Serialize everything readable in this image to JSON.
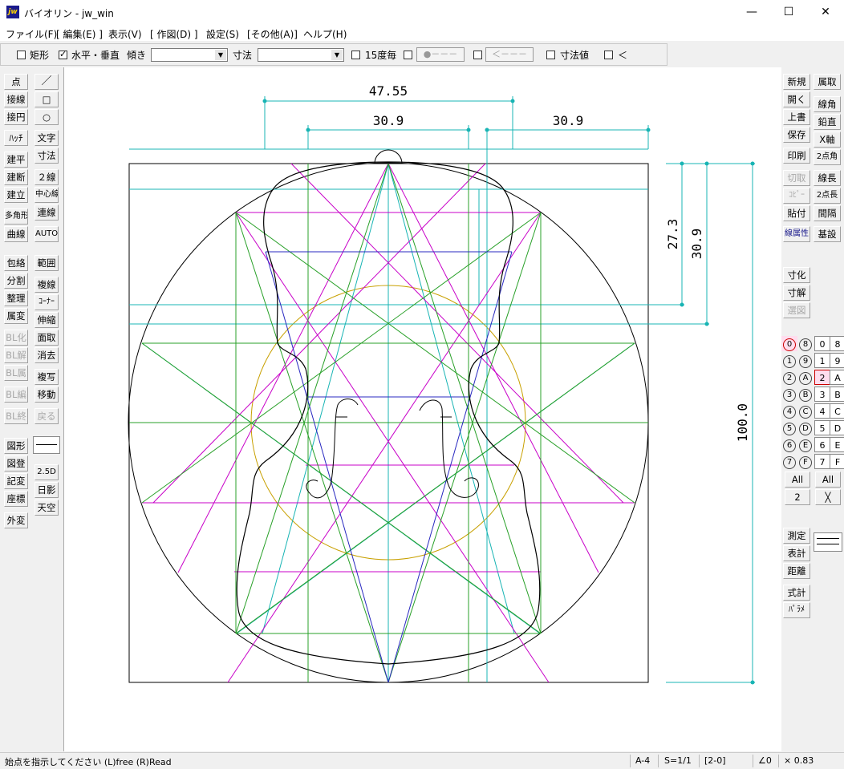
{
  "window": {
    "title": "バイオリン - jw_win",
    "app_icon": "jw",
    "minimize": "—",
    "maximize": "☐",
    "close": "✕"
  },
  "menu": [
    "ファイル(F)",
    "[ 編集(E) ]",
    "表示(V)",
    "[ 作図(D) ]",
    "設定(S)",
    "[その他(A)]",
    "ヘルプ(H)"
  ],
  "toolbar": {
    "rect_label": "矩形",
    "rect_checked": false,
    "hv_label": "水平・垂直",
    "hv_checked": true,
    "angle_label": "傾き",
    "angle_value": "",
    "dim_label": "寸法",
    "dim_value": "",
    "deg15_label": "15度毎",
    "deg15_checked": false,
    "pattern1": "●－－－",
    "pattern2": "＜－－－",
    "dimval_label": "寸法値",
    "dimval_checked": false,
    "lt_label": "＜"
  },
  "left_tools_a": [
    "点",
    "接線",
    "接円",
    "ﾊｯﾁ",
    "建平",
    "建断",
    "建立",
    "多角形",
    "曲線",
    "包絡",
    "分割",
    "整理",
    "属変",
    "BL化",
    "BL解",
    "BL属",
    "BL編",
    "BL終",
    "図形",
    "図登",
    "記変",
    "座標",
    "外変"
  ],
  "left_tools_b": [
    "／",
    "□",
    "○",
    "文字",
    "寸法",
    "２線",
    "中心線",
    "連線",
    "AUTO",
    "範囲",
    "複線",
    "ｺｰﾅｰ",
    "伸縮",
    "面取",
    "消去",
    "複写",
    "移動",
    "戻る",
    "2.5D",
    "日影",
    "天空"
  ],
  "right_tools_a": [
    "新規",
    "開く",
    "上書",
    "保存",
    "印刷",
    "切取",
    "ｺﾋﾟｰ",
    "貼付",
    "線属性",
    "寸化",
    "寸解",
    "選図",
    "測定",
    "表計",
    "距離",
    "式計",
    "ﾊﾟﾗﾒ"
  ],
  "right_tools_b": [
    "属取",
    "線角",
    "鉛直",
    "X軸",
    "2点角",
    "線長",
    "2点長",
    "間隔",
    "基設"
  ],
  "layers": {
    "group_col": [
      "0",
      "1",
      "2",
      "3",
      "4",
      "5",
      "6",
      "7"
    ],
    "group_col2": [
      "8",
      "9",
      "A",
      "B",
      "C",
      "D",
      "E",
      "F"
    ],
    "layer_col": [
      "0",
      "1",
      "2",
      "3",
      "4",
      "5",
      "6",
      "7"
    ],
    "layer_col2": [
      "8",
      "9",
      "A",
      "B",
      "C",
      "D",
      "E",
      "F"
    ],
    "all_left": "All",
    "two": "2",
    "all_right": "All",
    "cross": "╳"
  },
  "dimensions": [
    "47.55",
    "30.9",
    "30.9",
    "27.3",
    "30.9",
    "100.0"
  ],
  "colors": {
    "cyan": "#18b4b4",
    "magenta": "#c800c8",
    "green": "#28a028",
    "blue": "#2828c0",
    "gold": "#c8a000",
    "black": "#000000"
  },
  "status": {
    "message": "始点を指示してください (L)free (R)Read",
    "paper": "A-4",
    "scale": "S=1/1",
    "layer": "[2-0]",
    "angle": "∠0",
    "zoom": "× 0.83"
  }
}
